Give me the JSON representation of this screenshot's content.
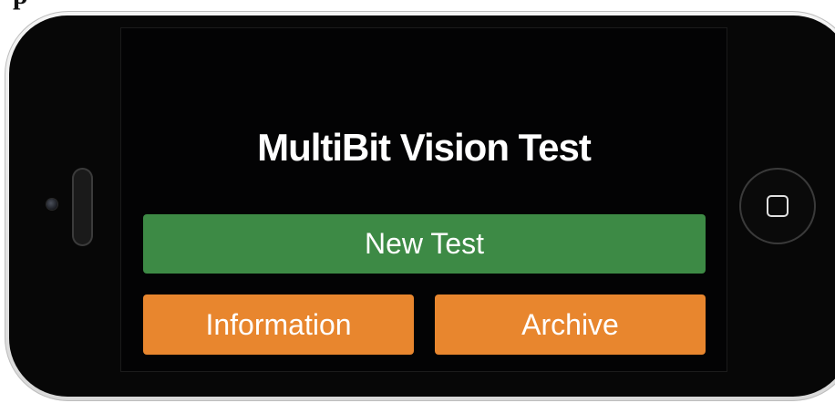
{
  "cropped_caption": "p",
  "app": {
    "title": "MultiBit Vision Test"
  },
  "buttons": {
    "new_test": "New Test",
    "information": "Information",
    "archive": "Archive"
  },
  "colors": {
    "new_test_bg": "#3d8a45",
    "secondary_bg": "#e8862e",
    "screen_bg": "#030304"
  }
}
